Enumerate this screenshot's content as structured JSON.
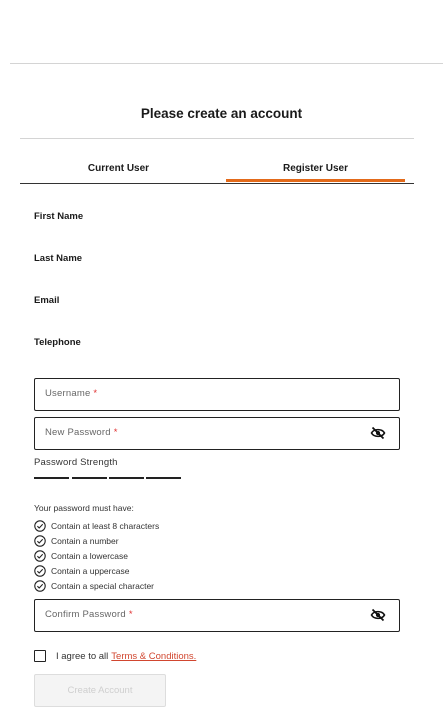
{
  "heading": "Please create an account",
  "tabs": {
    "current_user": "Current User",
    "register_user": "Register User",
    "active": "Register User",
    "accent_color": "#e36a1a"
  },
  "labels": {
    "first_name": "First Name",
    "last_name": "Last Name",
    "email": "Email",
    "telephone": "Telephone"
  },
  "fields": {
    "username": {
      "placeholder": "Username",
      "required_mark": "*",
      "value": ""
    },
    "new_password": {
      "placeholder": "New Password",
      "required_mark": "*",
      "value": "",
      "toggle_icon": "eye-slash-icon"
    },
    "confirm_password": {
      "placeholder": "Confirm Password",
      "required_mark": "*",
      "value": "",
      "toggle_icon": "eye-slash-icon"
    }
  },
  "password_strength": {
    "label": "Password Strength",
    "segments": 4,
    "filled_segments": 0
  },
  "rules": {
    "title": "Your password must have:",
    "icon": "check-circle-icon",
    "items": [
      "Contain at least 8 characters",
      "Contain a number",
      "Contain a lowercase",
      "Contain a uppercase",
      "Contain a special character"
    ]
  },
  "agree": {
    "prefix": "I agree to all",
    "link_text": "Terms & Conditions.",
    "checked": false,
    "link_color": "#d1462f"
  },
  "submit": {
    "label": "Create Account",
    "disabled": true
  },
  "colors": {
    "required": "#e03030",
    "border": "#222222"
  }
}
